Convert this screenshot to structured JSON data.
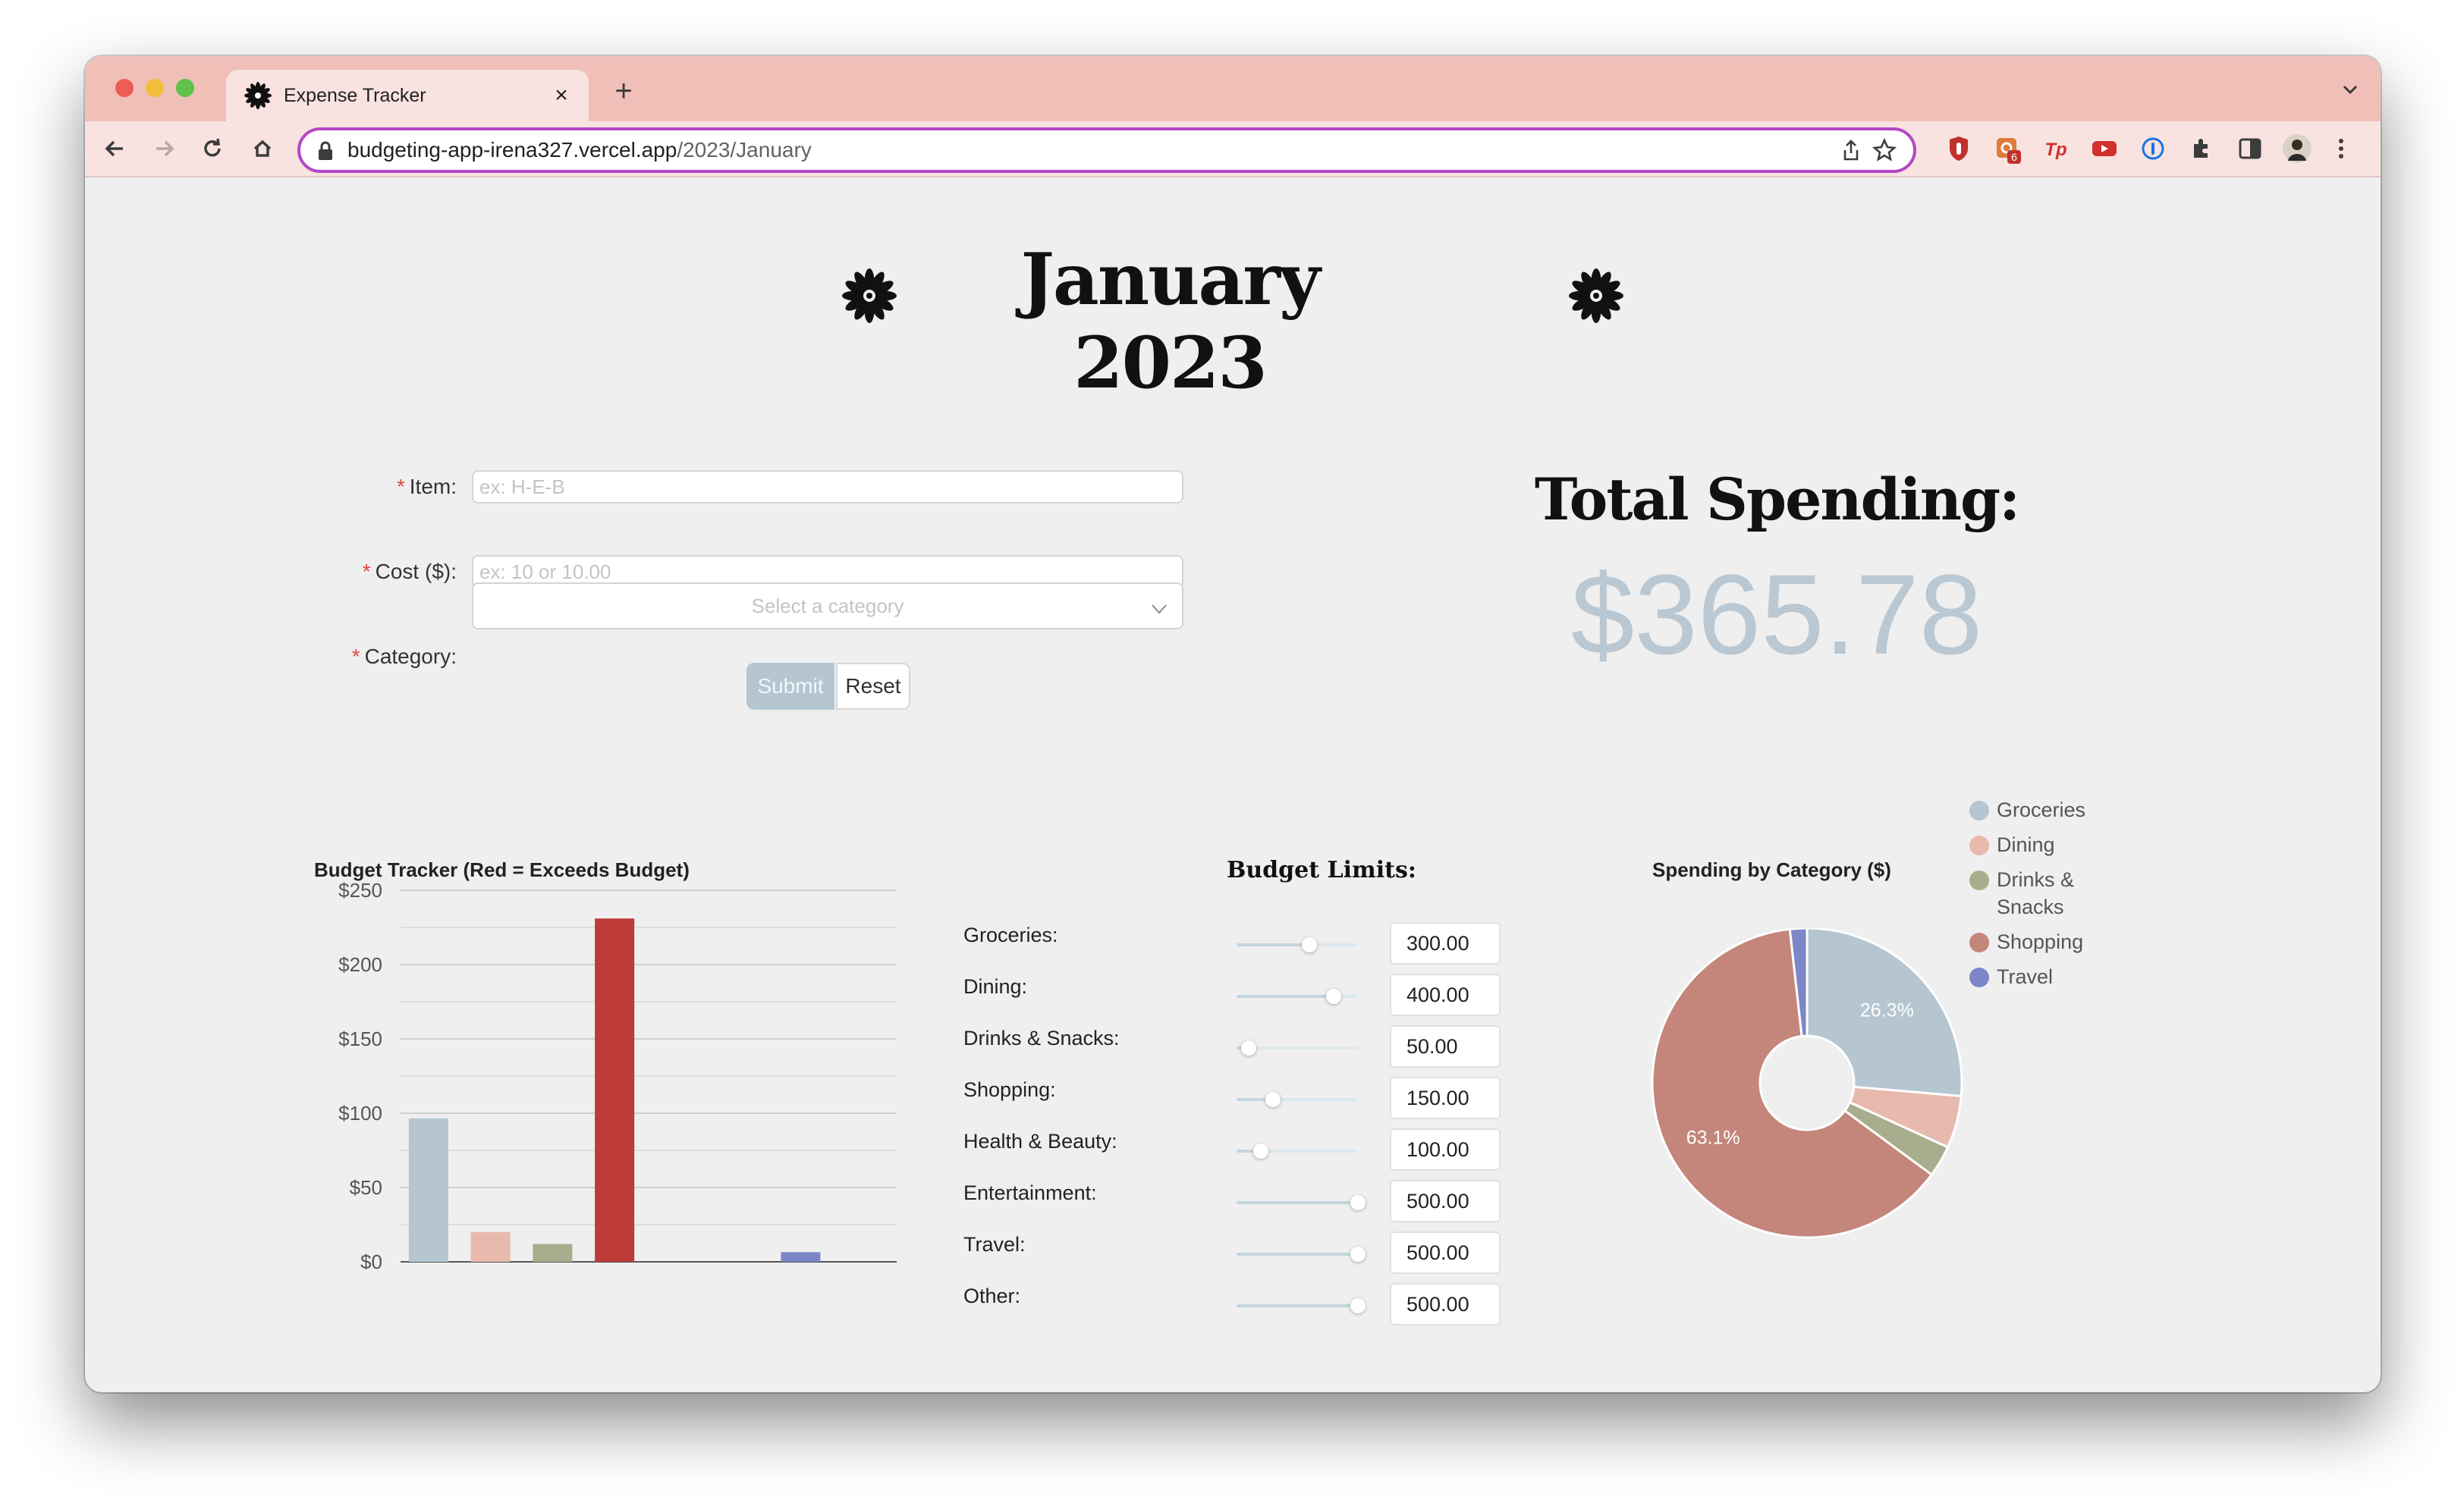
{
  "browser": {
    "tab_title": "Expense Tracker",
    "new_tab_label": "+",
    "url_host": "budgeting-app-irena327.vercel.app",
    "url_path": "/2023/January",
    "extension_badge": "6"
  },
  "page": {
    "title": "January 2023"
  },
  "form": {
    "item_label": "Item:",
    "item_placeholder": "ex: H-E-B",
    "cost_label": "Cost ($):",
    "cost_placeholder": "ex: 10 or 10.00",
    "category_label": "Category:",
    "category_placeholder": "Select a category",
    "required_mark": "*",
    "submit_label": "Submit",
    "reset_label": "Reset"
  },
  "total": {
    "label": "Total Spending:",
    "value": "$365.78"
  },
  "limits": {
    "title": "Budget Limits:",
    "slider_max": 500,
    "items": [
      {
        "label": "Groceries:",
        "value": "300.00",
        "amount": 300
      },
      {
        "label": "Dining:",
        "value": "400.00",
        "amount": 400
      },
      {
        "label": "Drinks & Snacks:",
        "value": "50.00",
        "amount": 50
      },
      {
        "label": "Shopping:",
        "value": "150.00",
        "amount": 150
      },
      {
        "label": "Health & Beauty:",
        "value": "100.00",
        "amount": 100
      },
      {
        "label": "Entertainment:",
        "value": "500.00",
        "amount": 500
      },
      {
        "label": "Travel:",
        "value": "500.00",
        "amount": 500
      },
      {
        "label": "Other:",
        "value": "500.00",
        "amount": 500
      }
    ]
  },
  "chart_data": [
    {
      "type": "bar",
      "title": "Budget Tracker (Red = Exceeds Budget)",
      "categories": [
        "Groceries",
        "Dining",
        "Drinks & Snacks",
        "Shopping",
        "Health & Beauty",
        "Entertainment",
        "Travel",
        "Other"
      ],
      "values": [
        96.5,
        20,
        12,
        231,
        0,
        0,
        6.5,
        0
      ],
      "colors": [
        "#b5c6d1",
        "#e8b9ad",
        "#a8ad8d",
        "#bd3c38",
        "#b5c6d1",
        "#b5c6d1",
        "#7d86c8",
        "#b5c6d1"
      ],
      "yticks": [
        "$0",
        "$50",
        "$100",
        "$150",
        "$200",
        "$250"
      ],
      "ylim": [
        0,
        250
      ],
      "grid": true
    },
    {
      "type": "pie",
      "title": "Spending by Category ($)",
      "labels": [
        "Groceries",
        "Dining",
        "Drinks & Snacks",
        "Shopping",
        "Travel"
      ],
      "values": [
        96.5,
        20,
        12,
        231,
        6.5
      ],
      "colors": [
        "#b5c6d1",
        "#e8b9ad",
        "#a8ad8d",
        "#c4867a",
        "#7d86c8"
      ],
      "slice_labels": [
        {
          "index": 0,
          "text": "26.3%"
        },
        {
          "index": 3,
          "text": "63.1%"
        }
      ],
      "legend": [
        "Groceries",
        "Dining",
        "Drinks &",
        "Snacks",
        "Shopping",
        "Travel"
      ],
      "legend_position": "right",
      "donut": true
    }
  ]
}
